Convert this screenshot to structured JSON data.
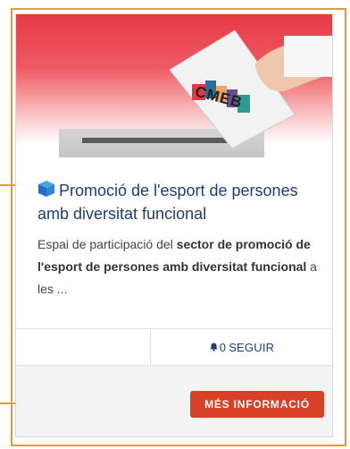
{
  "card": {
    "image_logo_text": "CMEB",
    "title_icon": "cube-icon",
    "title": "Promoció de l'esport de persones amb diversitat funcional",
    "description": {
      "prefix": "Espai de participació del ",
      "bold": "sector de promoció de l'esport de persones amb diversitat funcional",
      "suffix": " a les ..."
    },
    "follow": {
      "icon": "bell-icon",
      "count": "0",
      "label": "SEGUIR"
    },
    "more_button": "MÉS INFORMACIÓ"
  },
  "colors": {
    "frame": "#e29a3c",
    "title": "#1f3c7a",
    "button": "#d84126",
    "hero_red": "#e63a46"
  }
}
